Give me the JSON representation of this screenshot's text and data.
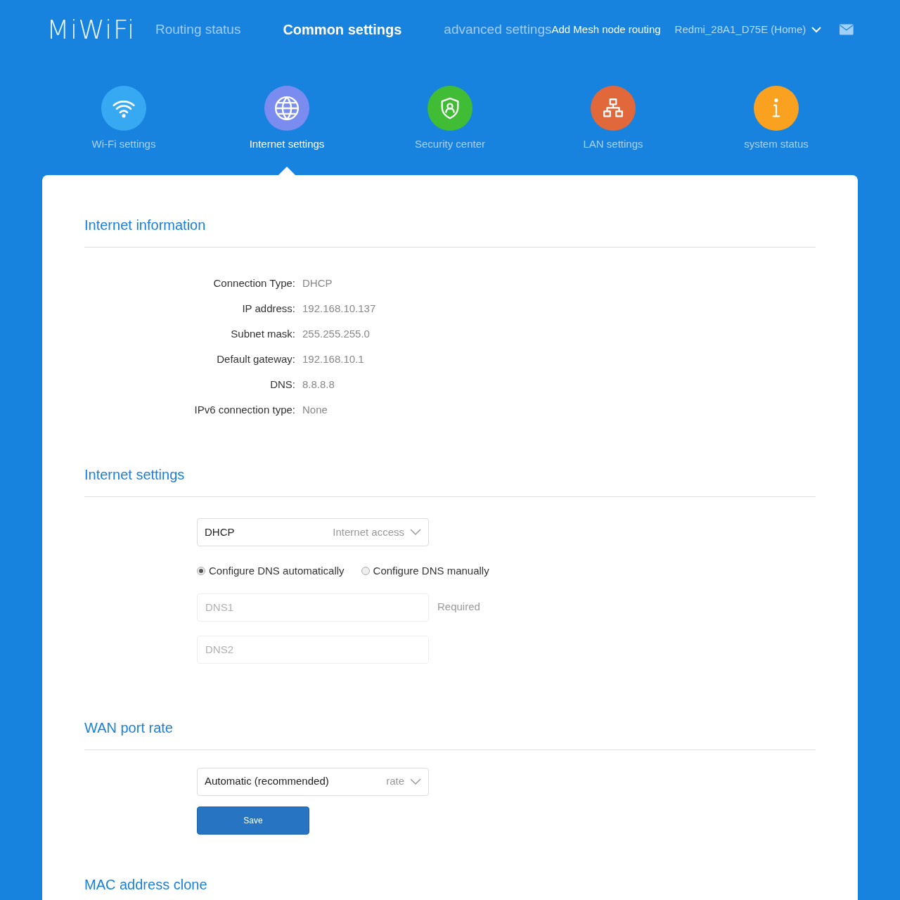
{
  "header": {
    "logo": "MiWiFi",
    "nav": [
      {
        "label": "Routing status",
        "selected": false
      },
      {
        "label": "Common settings",
        "selected": true
      },
      {
        "label": "advanced settings",
        "selected": false
      }
    ],
    "mesh_link": "Add Mesh node routing",
    "router": "Redmi_28A1_D75E (Home)"
  },
  "modules": [
    {
      "label": "Wi-Fi settings",
      "kind": "wifi",
      "color": "#36a9f2",
      "selected": false
    },
    {
      "label": "Internet settings",
      "kind": "globe",
      "color": "#7b8cf0",
      "selected": true
    },
    {
      "label": "Security center",
      "kind": "shield",
      "color": "#41bd35",
      "selected": false
    },
    {
      "label": "LAN settings",
      "kind": "lan",
      "color": "#e0683a",
      "selected": false
    },
    {
      "label": "system status",
      "kind": "info",
      "color": "#faa21f",
      "selected": false
    }
  ],
  "internet_information": {
    "title": "Internet information",
    "rows": [
      {
        "label": "Connection Type:",
        "value": "DHCP"
      },
      {
        "label": "IP address:",
        "value": "192.168.10.137"
      },
      {
        "label": "Subnet mask:",
        "value": "255.255.255.0"
      },
      {
        "label": "Default gateway:",
        "value": "192.168.10.1"
      },
      {
        "label": "DNS:",
        "value": "8.8.8.8"
      },
      {
        "label": "IPv6 connection type:",
        "value": "None"
      }
    ]
  },
  "internet_settings": {
    "title": "Internet settings",
    "mode": {
      "value": "DHCP",
      "hint": "Internet access"
    },
    "dns_options": [
      {
        "label": "Configure DNS automatically",
        "selected": true
      },
      {
        "label": "Configure DNS manually",
        "selected": false
      }
    ],
    "dns_fields": [
      {
        "placeholder": "DNS1",
        "note": "Required"
      },
      {
        "placeholder": "DNS2"
      }
    ]
  },
  "wan_port_rate": {
    "title": "WAN port rate",
    "rate": {
      "value": "Automatic (recommended)",
      "hint": "rate"
    },
    "save": "Save"
  },
  "mac_address_clone": {
    "title": "MAC address clone"
  }
}
